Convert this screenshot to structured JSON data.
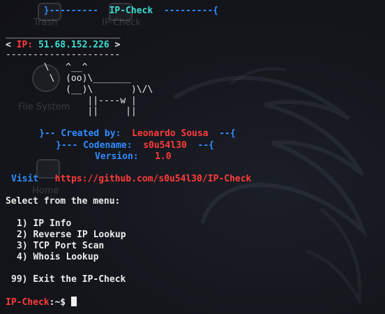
{
  "theme": {
    "background": "#131419",
    "blue": "#2f8cff",
    "cyan": "#3fdcd1",
    "red": "#ff3b3b",
    "text": "#ececec"
  },
  "desktop_ghosts": {
    "trash_label": "Trash",
    "ipcheck_label": "IP-Check",
    "filesystem_label": "File System",
    "home_label": "Home"
  },
  "banner": {
    "left_brace": "}---------",
    "title": "IP-Check",
    "right_brace": "---------{"
  },
  "ip_box": {
    "top_rule": "_____________________",
    "open": "< ",
    "label": "IP:",
    "value": "51.68.152.226",
    "close": " >",
    "bottom_rule": "---------------------"
  },
  "cow_art": [
    "       \\   ^__^",
    "        \\  (oo)\\_______",
    "           (__)\\       )\\/\\",
    "               ||----w |",
    "               ||     ||"
  ],
  "credits": {
    "created_prefix": "}-- Created by:",
    "created_name": "Leonardo Sousa",
    "created_suffix": "--{",
    "codename_prefix": "}--- Codename:",
    "codename_value": "s0u54l30",
    "codename_suffix": "--{",
    "version_label": "Version:",
    "version_value": "1.0"
  },
  "visit": {
    "label": "Visit",
    "url": "https://github.com/s0u54l30/IP-Check"
  },
  "menu": {
    "heading": "Select from the menu:",
    "items": [
      "1) IP Info",
      "2) Reverse IP Lookup",
      "3) TCP Port Scan",
      "4) Whois Lookup"
    ],
    "exit": "99) Exit the IP-Check"
  },
  "prompt": {
    "name": "IP-Check",
    "suffix": ":~$"
  }
}
